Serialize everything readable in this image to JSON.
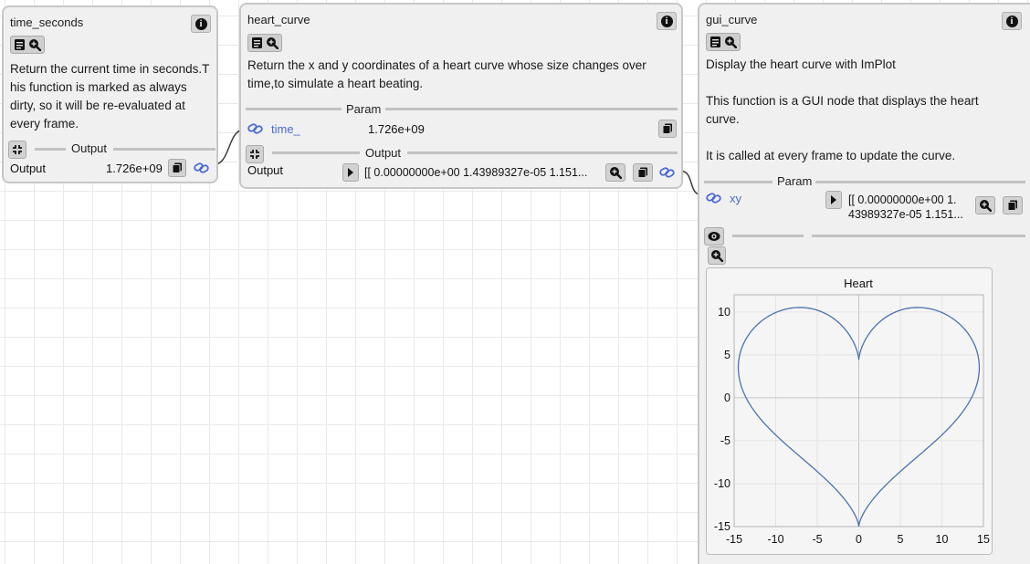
{
  "nodes": {
    "time_seconds": {
      "title": "time_seconds",
      "doc": "Return the current time in seconds.T his function is marked as always dirty, so it will be re-evaluated at every frame.",
      "output_section": "Output",
      "output_label": "Output",
      "output_value": "1.726e+09"
    },
    "heart_curve": {
      "title": "heart_curve",
      "doc": "Return the x and y coordinates of a heart curve whose size changes over time,to simulate a heart beating.",
      "param_section": "Param",
      "param_name": "time_",
      "param_value": "1.726e+09",
      "output_section": "Output",
      "output_label": "Output",
      "output_value": "[[ 0.00000000e+00  1.43989327e-05  1.151..."
    },
    "gui_curve": {
      "title": "gui_curve",
      "doc_line1": "Display the heart curve with ImPlot",
      "doc_line2": "This function is a GUI node that displays the heart curve.",
      "doc_line3": "It is called at every frame to update the curve.",
      "param_section": "Param",
      "param_name": "xy",
      "param_value_line1": "[[ 0.00000000e+00  1.",
      "param_value_line2": "43989327e-05  1.151..."
    }
  },
  "icons": {
    "info": "info-icon",
    "doc": "document-icon",
    "zoom": "zoom-icon",
    "collapse": "collapse-icon",
    "copy": "copy-icon",
    "link": "link-icon",
    "play": "play-icon",
    "eye": "eye-icon"
  },
  "colors": {
    "accent": "#4a6bd0",
    "curve": "#4c72b0",
    "node_bg": "#f0f0f0"
  },
  "chart_data": {
    "type": "line",
    "title": "Heart",
    "curve": "heart: x = 16 sin^3(t), y = 13 cos t - 5 cos 2t - 2 cos 3t - cos 4t (scaled)",
    "xlim": [
      -15,
      15
    ],
    "ylim": [
      -15,
      12
    ],
    "x_ticks": [
      "-15",
      "-10",
      "-5",
      "0",
      "5",
      "10",
      "15"
    ],
    "y_ticks": [
      "10",
      "5",
      "0",
      "-5",
      "-10",
      "-15"
    ],
    "x_tick_values": [
      -15,
      -10,
      -5,
      0,
      5,
      10,
      15
    ],
    "y_tick_values": [
      10,
      5,
      0,
      -5,
      -10,
      -15
    ],
    "grid": true
  }
}
